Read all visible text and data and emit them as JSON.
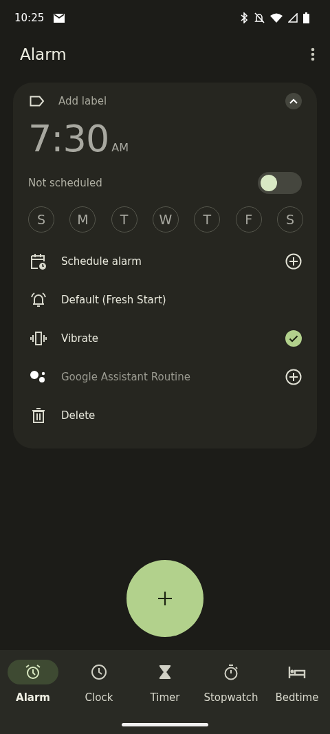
{
  "status_bar": {
    "time": "10:25"
  },
  "app_bar": {
    "title": "Alarm"
  },
  "alarm": {
    "label_placeholder": "Add label",
    "expanded": true,
    "time": "7:30",
    "period": "AM",
    "schedule": "Not scheduled",
    "on": false,
    "days": [
      {
        "letter": "S",
        "selected": false
      },
      {
        "letter": "M",
        "selected": false
      },
      {
        "letter": "T",
        "selected": false
      },
      {
        "letter": "W",
        "selected": false
      },
      {
        "letter": "T",
        "selected": false
      },
      {
        "letter": "F",
        "selected": false
      },
      {
        "letter": "S",
        "selected": false
      }
    ],
    "options": [
      {
        "kind": "action",
        "label": "Schedule alarm",
        "disabled": false
      },
      {
        "kind": "plain",
        "label": "Default (Fresh Start)",
        "disabled": false
      },
      {
        "kind": "toggle",
        "label": "Vibrate",
        "disabled": false,
        "checked": true
      },
      {
        "kind": "action",
        "label": "Google Assistant Routine",
        "disabled": true
      },
      {
        "kind": "plain",
        "label": "Delete",
        "disabled": false
      }
    ]
  },
  "nav": [
    {
      "label": "Alarm",
      "selected": true
    },
    {
      "label": "Clock",
      "selected": false
    },
    {
      "label": "Timer",
      "selected": false
    },
    {
      "label": "Stopwatch",
      "selected": false
    },
    {
      "label": "Bedtime",
      "selected": false
    }
  ]
}
